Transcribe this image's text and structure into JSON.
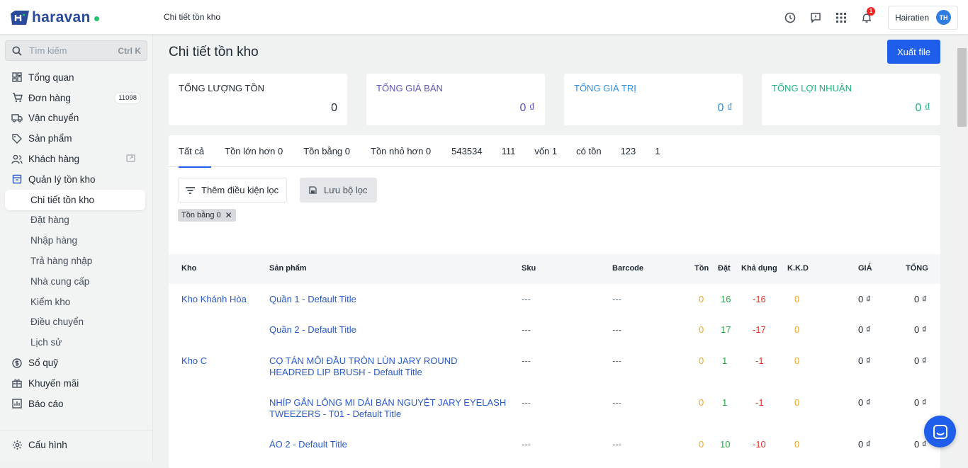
{
  "topbar": {
    "brand": "haravan",
    "breadcrumb": "Chi tiết tồn kho",
    "notif_count": "1",
    "user_name": "Hairatien",
    "user_initials": "TH"
  },
  "sidebar": {
    "search_placeholder": "Tìm kiếm",
    "search_shortcut": "Ctrl K",
    "items": [
      {
        "label": "Tổng quan",
        "icon": "dashboard-icon"
      },
      {
        "label": "Đơn hàng",
        "icon": "cart-icon",
        "count": "11098"
      },
      {
        "label": "Vận chuyển",
        "icon": "truck-icon"
      },
      {
        "label": "Sản phẩm",
        "icon": "tag-icon"
      },
      {
        "label": "Khách hàng",
        "icon": "users-icon"
      },
      {
        "label": "Quản lý tồn kho",
        "icon": "inventory-icon"
      }
    ],
    "sub_items": [
      "Chi tiết tồn kho",
      "Đặt hàng",
      "Nhập hàng",
      "Trả hàng nhập",
      "Nhà cung cấp",
      "Kiểm kho",
      "Điều chuyển",
      "Lịch sử"
    ],
    "items2": [
      {
        "label": "Sổ quỹ",
        "icon": "cash-icon"
      },
      {
        "label": "Khuyến mãi",
        "icon": "gift-icon"
      },
      {
        "label": "Báo cáo",
        "icon": "report-icon"
      }
    ],
    "settings": "Cấu hình"
  },
  "main": {
    "title": "Chi tiết tồn kho",
    "export_label": "Xuất file",
    "cards": [
      {
        "label": "TỔNG LƯỢNG TỒN",
        "value": "0",
        "color": "#212b35"
      },
      {
        "label": "TỔNG GIÁ BÁN",
        "value": "0 ₫",
        "color": "#5b55b8"
      },
      {
        "label": "TỔNG GIÁ TRỊ",
        "value": "0 ₫",
        "color": "#2f8ee0"
      },
      {
        "label": "TỔNG LỢI NHUẬN",
        "value": "0 ₫",
        "color": "#1fb07a"
      }
    ],
    "tabs": [
      "Tất cả",
      "Tồn lớn hơn 0",
      "Tồn bằng 0",
      "Tồn nhỏ hơn 0",
      "543534",
      "111",
      "vốn 1",
      "có tồn",
      "123",
      "1"
    ],
    "add_filter": "Thêm điều kiện lọc",
    "save_filter": "Lưu bộ lọc",
    "chip": "Tồn bằng 0",
    "columns": [
      "Kho",
      "Sản phẩm",
      "Sku",
      "Barcode",
      "Tồn",
      "Đặt",
      "Khả dụng",
      "K.K.D",
      "GIÁ",
      "TỔNG"
    ],
    "rows": [
      {
        "kho": "Kho Khánh Hòa",
        "product": "Quần 1 - Default Title",
        "sku": "---",
        "barcode": "---",
        "ton": "0",
        "dat": "16",
        "kha_dung": "-16",
        "kkd": "0",
        "gia": "0 ₫",
        "tong": "0 ₫"
      },
      {
        "kho": "",
        "product": "Quần 2 - Default Title",
        "sku": "---",
        "barcode": "---",
        "ton": "0",
        "dat": "17",
        "kha_dung": "-17",
        "kkd": "0",
        "gia": "0 ₫",
        "tong": "0 ₫"
      },
      {
        "kho": "Kho C",
        "product": "CỌ TÁN MÔI ĐẦU TRÒN LÙN JARY ROUND HEADRED LIP BRUSH - Default Title",
        "sku": "---",
        "barcode": "---",
        "ton": "0",
        "dat": "1",
        "kha_dung": "-1",
        "kkd": "0",
        "gia": "0 ₫",
        "tong": "0 ₫"
      },
      {
        "kho": "",
        "product": "NHÍP GẮN LÔNG MI DẢI BÁN NGUYỆT JARY EYELASH TWEEZERS - T01 - Default Title",
        "sku": "---",
        "barcode": "---",
        "ton": "0",
        "dat": "1",
        "kha_dung": "-1",
        "kkd": "0",
        "gia": "0 ₫",
        "tong": "0 ₫"
      },
      {
        "kho": "",
        "product": "ÁO 2 - Default Title",
        "sku": "---",
        "barcode": "---",
        "ton": "0",
        "dat": "10",
        "kha_dung": "-10",
        "kkd": "0",
        "gia": "0 ₫",
        "tong": "0 ₫"
      }
    ]
  },
  "colors": {
    "accent": "#1f5eea",
    "link": "#2a5ac8",
    "ton": "#f0a71e",
    "dat": "#28a745",
    "kha_dung": "#e0322a"
  }
}
